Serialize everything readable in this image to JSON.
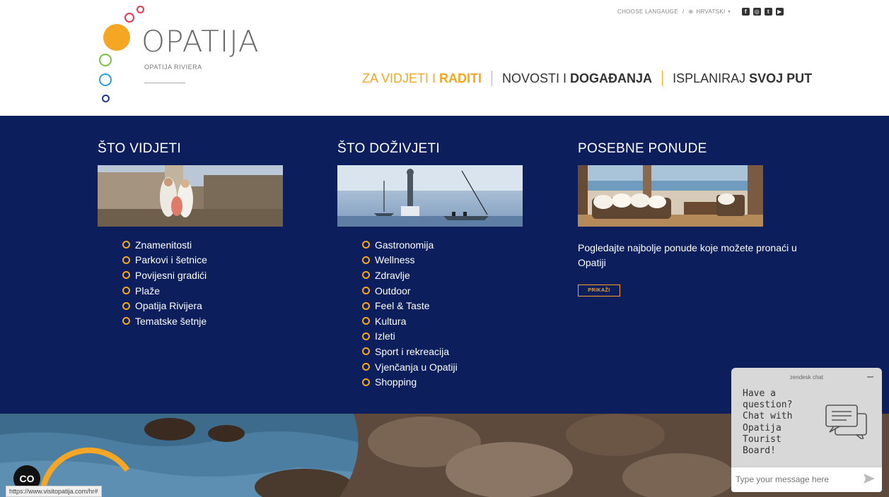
{
  "header": {
    "logo": {
      "brand": "OPATIJA",
      "subtitle": "OPATIJA RIVIERA"
    },
    "topbar": {
      "choose_language": "CHOOSE LANGAUGE",
      "separator": "/",
      "language": "HRVATSKI",
      "social": [
        "facebook-icon",
        "instagram-icon",
        "twitter-icon",
        "youtube-icon"
      ]
    },
    "nav": [
      {
        "light": "ZA VIDJETI I",
        "bold": "RADITI",
        "active": true
      },
      {
        "light": "NOVOSTI I",
        "bold": "DOGAĐANJA",
        "active": false
      },
      {
        "light": "ISPLANIRAJ",
        "bold": "SVOJ PUT",
        "active": false
      }
    ]
  },
  "mega_menu": {
    "what_to_see": {
      "title": "ŠTO VIDJETI",
      "items": [
        "Znamenitosti",
        "Parkovi i šetnice",
        "Povijesni gradići",
        "Plaže",
        "Opatija Rivijera",
        "Tematske šetnje"
      ]
    },
    "what_to_experience": {
      "title": "ŠTO DOŽIVJETI",
      "items": [
        "Gastronomija",
        "Wellness",
        "Zdravlje",
        "Outdoor",
        "Feel & Taste",
        "Kultura",
        "Izleti",
        "Sport i rekreacija",
        "Vjenčanja u Opatiji",
        "Shopping"
      ]
    },
    "special_offers": {
      "title": "POSEBNE PONUDE",
      "text": "Pogledajte najbolje ponude koje možete pronaći u Opatiji",
      "button": "PRIKAŽI"
    }
  },
  "cookie_button": "CO",
  "status_url": "https://www.visitopatija.com/hr#",
  "chat": {
    "header": "zendesk chat",
    "minimize": "–",
    "message": "Have a question? Chat with Opatija Tourist Board!",
    "placeholder": "Type your message here"
  },
  "colors": {
    "accent": "#f5a623",
    "menu_background": "#0c1e5b"
  }
}
